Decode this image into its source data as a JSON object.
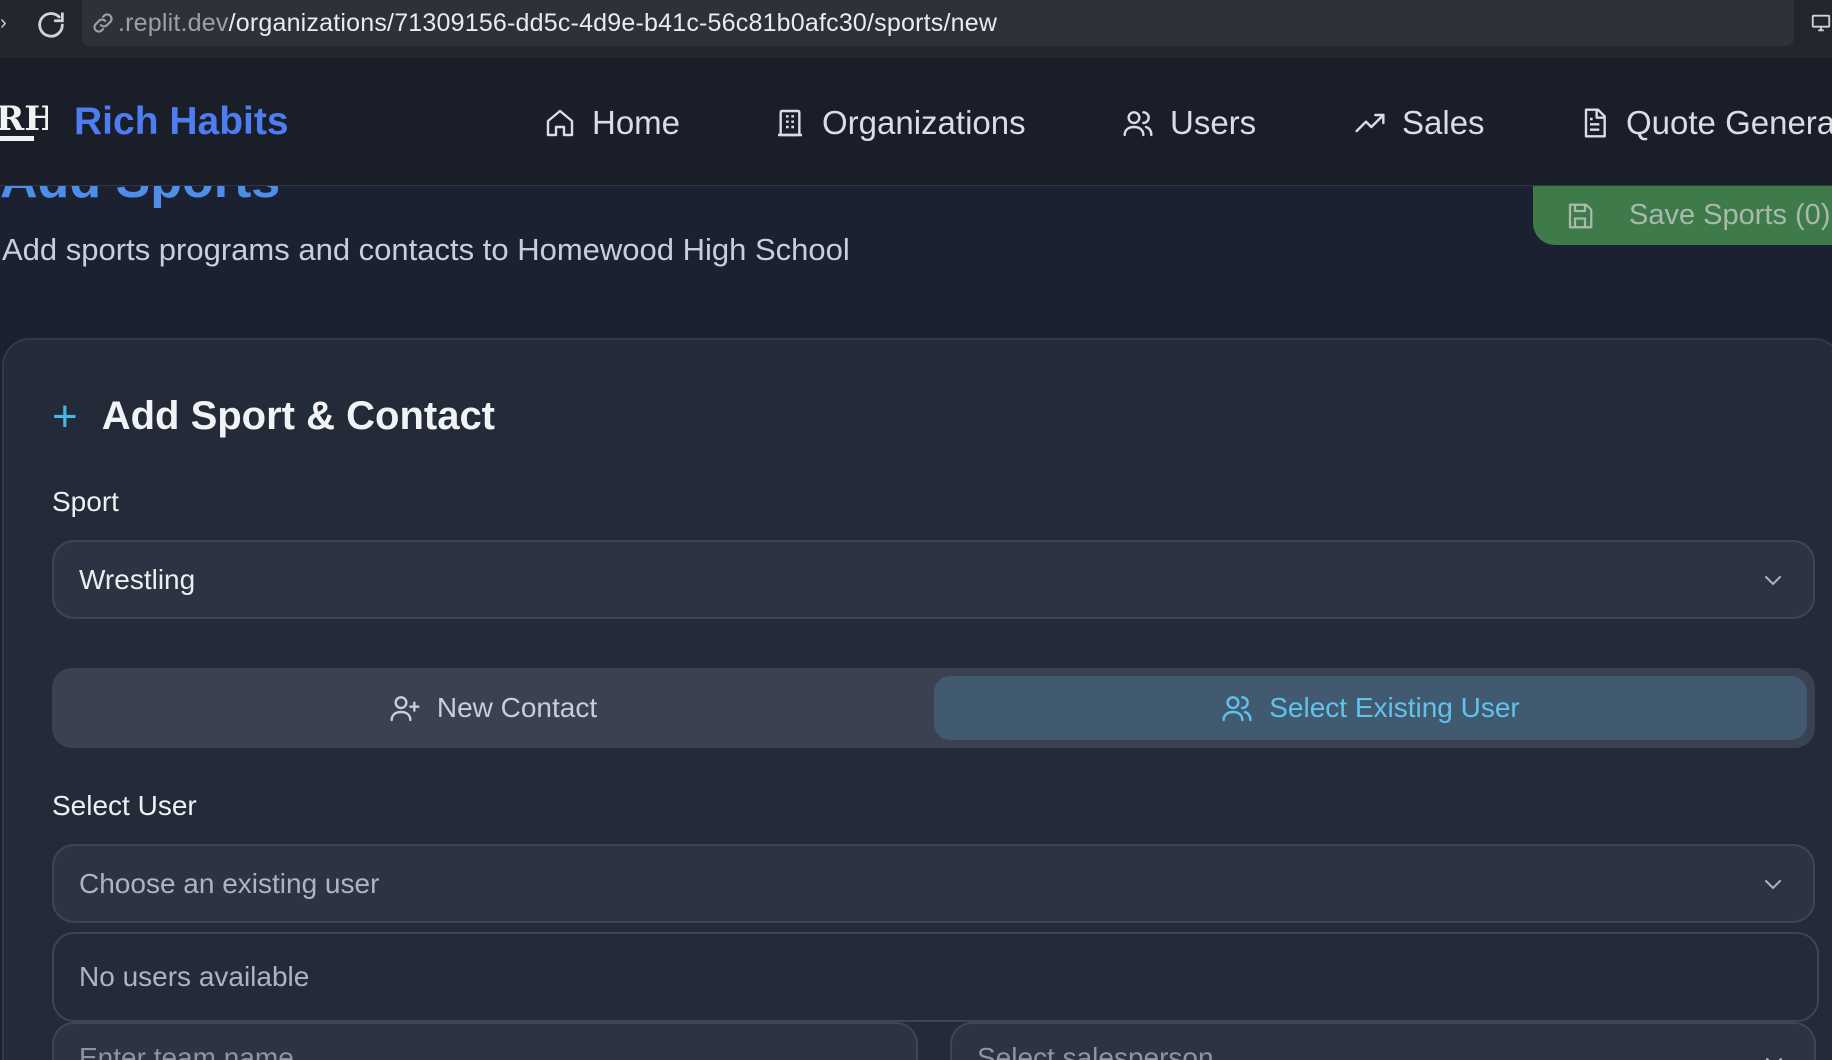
{
  "browser": {
    "url_dim": ".replit.dev",
    "url_path": "/organizations/71309156-dd5c-4d9e-b41c-56c81b0afc30/sports/new"
  },
  "header": {
    "brand": "Rich Habits",
    "nav": [
      {
        "label": "Home",
        "icon": "home-icon"
      },
      {
        "label": "Organizations",
        "icon": "building-icon"
      },
      {
        "label": "Users",
        "icon": "users-icon"
      },
      {
        "label": "Sales",
        "icon": "trending-up-icon"
      },
      {
        "label": "Quote Genera",
        "icon": "file-text-icon"
      }
    ]
  },
  "page": {
    "title": "Add Sports",
    "subtitle": "Add sports programs and contacts to Homewood High School",
    "save_label": "Save Sports (0)"
  },
  "form": {
    "card_title": "Add Sport & Contact",
    "sport_label": "Sport",
    "sport_value": "Wrestling",
    "toggle": {
      "new_contact": "New Contact",
      "select_existing": "Select Existing User",
      "active": "select_existing"
    },
    "select_user_label": "Select User",
    "select_user_placeholder": "Choose an existing user",
    "no_users_text": "No users available",
    "team_name_placeholder": "Enter team name",
    "salesperson_placeholder": "Select salesperson"
  },
  "colors": {
    "accent": "#4d7df0",
    "save_green": "#3f7a4a",
    "toggle_active_text": "#5fc3ee"
  }
}
